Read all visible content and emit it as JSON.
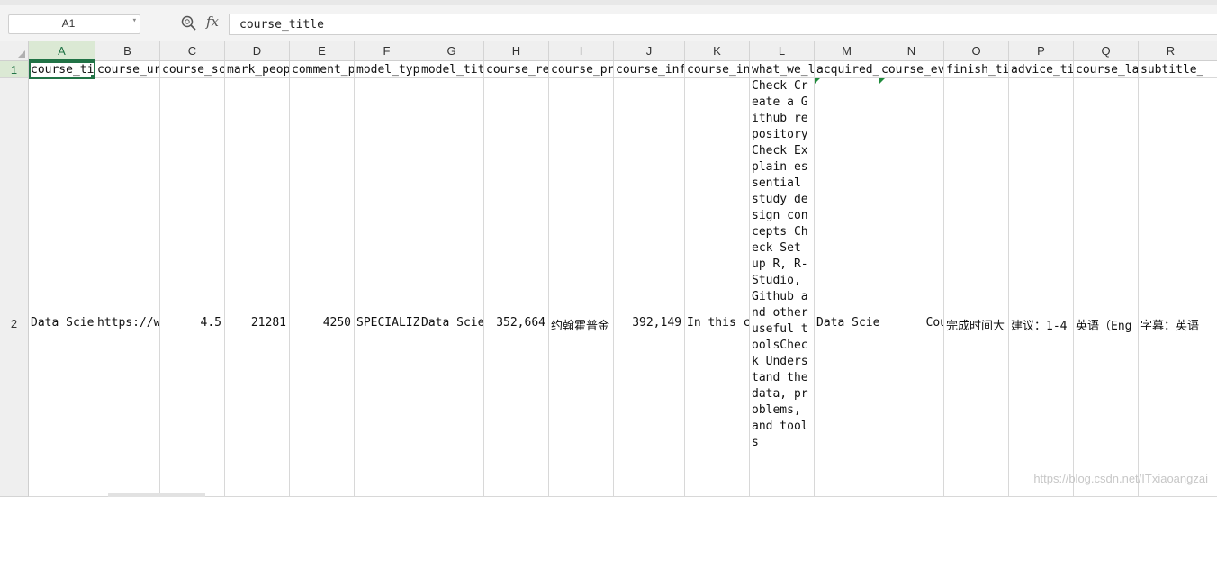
{
  "name_box": "A1",
  "formula_icon": "fx",
  "formula_bar": "course_title",
  "columns": [
    "A",
    "B",
    "C",
    "D",
    "E",
    "F",
    "G",
    "H",
    "I",
    "J",
    "K",
    "L",
    "M",
    "N",
    "O",
    "P",
    "Q",
    "R"
  ],
  "rows": [
    "1",
    "2"
  ],
  "row1": [
    "course_ti",
    "course_ur",
    "course_sc",
    "mark_peop",
    "comment_p",
    "model_typ",
    "model_tit",
    "course_re",
    "course_pr",
    "course_inf",
    "course_in",
    "what_we_l",
    "acquired_",
    "course_ev",
    "finish_ti",
    "advice_ti",
    "course_la",
    "subtitle_la"
  ],
  "row2": {
    "A": "Data Scie",
    "B": "https://w",
    "C": "4.5",
    "D": "21281",
    "E": "4250",
    "F": "SPECIALIZ",
    "G": "Data Scie",
    "H": "352,664",
    "I": "约翰霍普金",
    "J": "392,149",
    "K": "In this c",
    "L": "Check Create a Github repositoryCheck Explain essential study design concepts Check Set up R, R-Studio, Github and other useful toolsCheck Understand the data, problems, and tools",
    "M": "Data Scie",
    "N": "Cou",
    "O": "完成时间大",
    "P": "建议：1-4",
    "Q": "英语（Eng",
    "R": "字幕：英语"
  },
  "watermark": "https://blog.csdn.net/ITxiaoangzai"
}
